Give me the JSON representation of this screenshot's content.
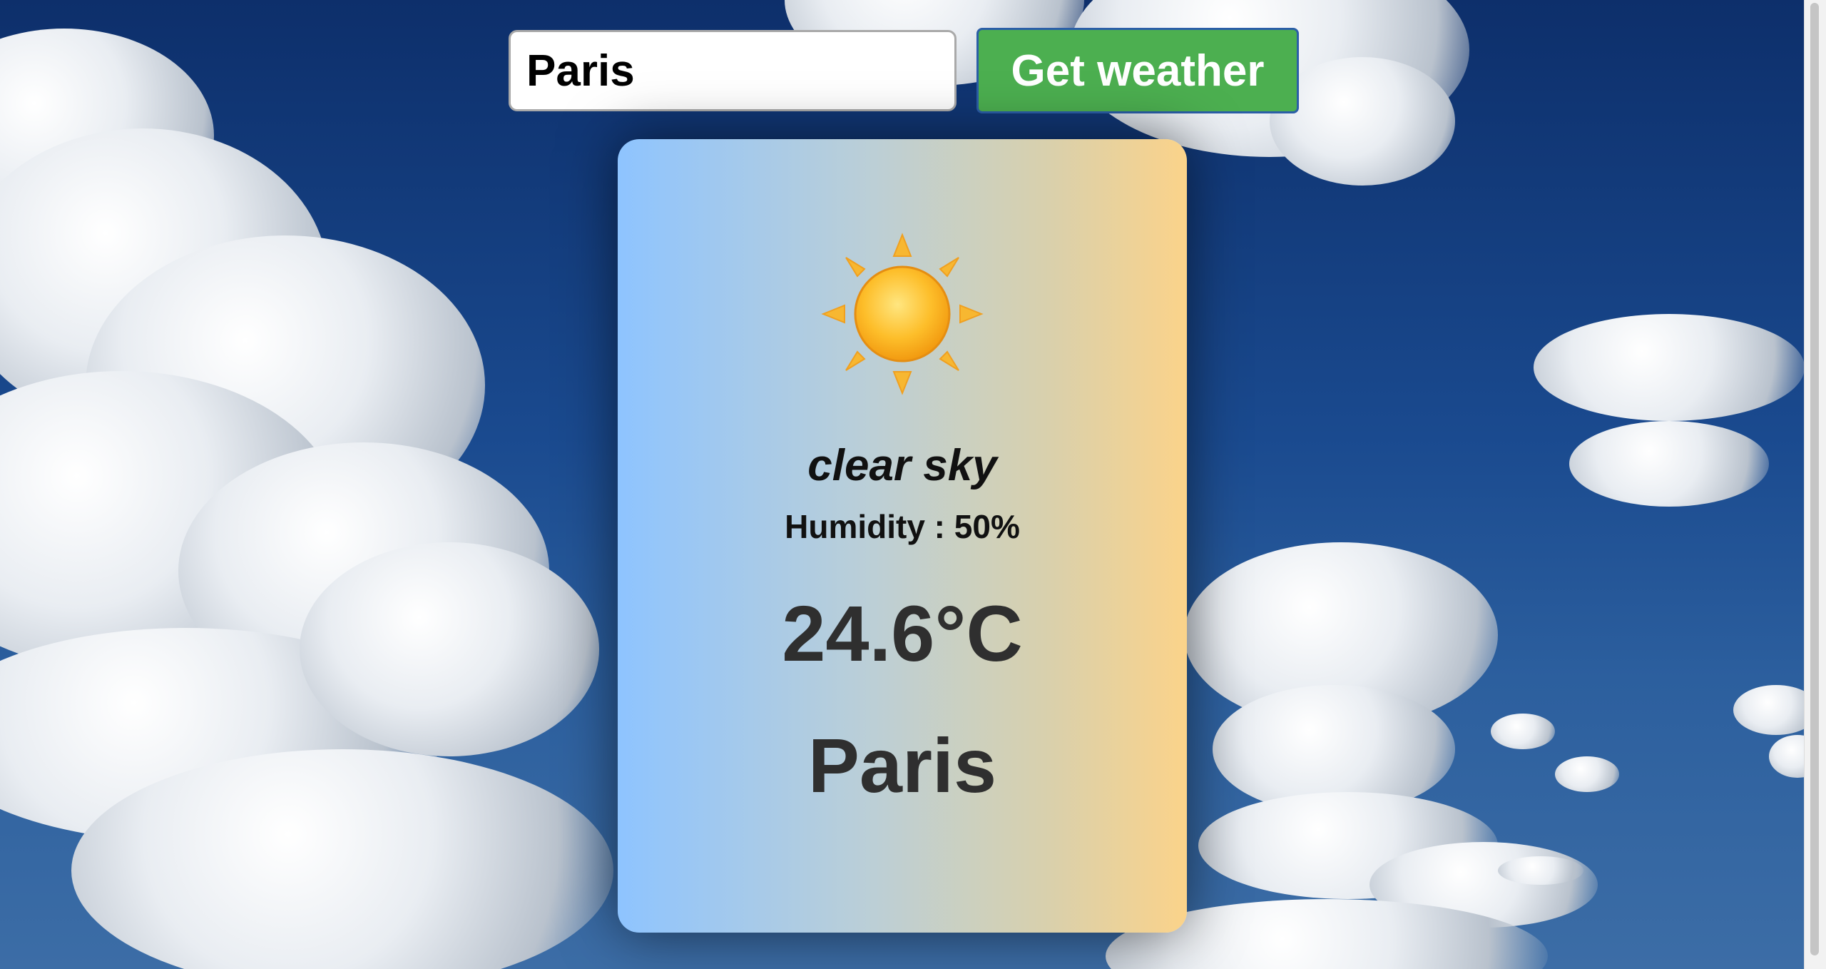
{
  "search": {
    "value": "Paris",
    "button_label": "Get weather"
  },
  "weather": {
    "icon": "sun-icon",
    "description": "clear sky",
    "humidity": "Humidity : 50%",
    "temperature": "24.6°C",
    "city": "Paris"
  },
  "colors": {
    "button": "#4caf50",
    "card_gradient_start": "#8ec4ff",
    "card_gradient_end": "#fbd38a",
    "text_dark": "#2f2f2f"
  }
}
